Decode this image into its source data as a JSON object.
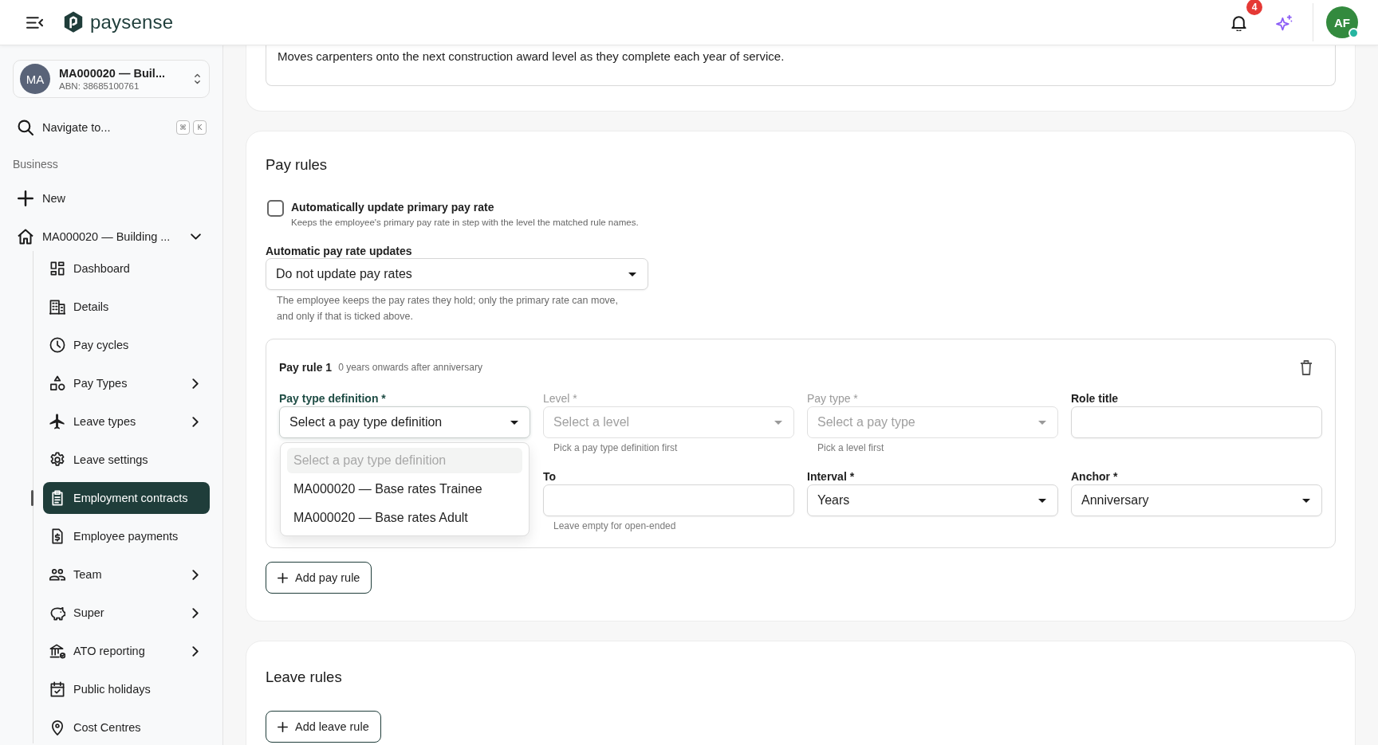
{
  "header": {
    "logo": "paysense",
    "notifications": "4",
    "avatar": {
      "initials": "AF",
      "online": true
    }
  },
  "sidebar": {
    "business": {
      "initials": "MA",
      "name": "MA000020 — Buil...",
      "abn": "ABN: 38685100761"
    },
    "search": {
      "label": "Navigate to...",
      "keys": [
        "⌘",
        "K"
      ]
    },
    "section_title": "Business",
    "new_item": "New",
    "organisation": {
      "label": "MA000020 — Building ...",
      "expanded": true,
      "children": [
        {
          "label": "Dashboard",
          "has_submenu": false,
          "selected": false
        },
        {
          "label": "Details",
          "has_submenu": false,
          "selected": false
        },
        {
          "label": "Pay cycles",
          "has_submenu": false,
          "selected": false
        },
        {
          "label": "Pay Types",
          "has_submenu": true,
          "selected": false
        },
        {
          "label": "Leave types",
          "has_submenu": true,
          "selected": false
        },
        {
          "label": "Leave settings",
          "has_submenu": false,
          "selected": false
        },
        {
          "label": "Employment contracts",
          "has_submenu": false,
          "selected": true
        },
        {
          "label": "Employee payments",
          "has_submenu": false,
          "selected": false
        },
        {
          "label": "Team",
          "has_submenu": true,
          "selected": false
        },
        {
          "label": "Super",
          "has_submenu": true,
          "selected": false
        },
        {
          "label": "ATO reporting",
          "has_submenu": true,
          "selected": false
        },
        {
          "label": "Public holidays",
          "has_submenu": false,
          "selected": false
        },
        {
          "label": "Cost Centres",
          "has_submenu": false,
          "selected": false
        }
      ]
    }
  },
  "previous_section": {
    "description": "Moves carpenters onto the next construction award level as they complete each year of service."
  },
  "pay_rules": {
    "title": "Pay rules",
    "auto_update": {
      "label": "Automatically update primary pay rate",
      "description": "Keeps the employee's primary pay rate in step with the level the matched rule names.",
      "checked": false
    },
    "rate_updates": {
      "label": "Automatic pay rate updates",
      "value": "Do not update pay rates",
      "help": "The employee keeps the pay rates they hold; only the primary rate can move, and only if that is ticked above."
    },
    "rules": [
      {
        "title": "Pay rule 1",
        "summary": "0 years onwards after anniversary",
        "rows": [
          [
            {
              "label": "Pay type definition *",
              "kind": "select",
              "value": "Select a pay type definition",
              "disabled": false,
              "open": true,
              "options": [
                {
                  "label": "Select a pay type definition",
                  "disabled": true,
                  "selected": true
                },
                {
                  "label": "MA000020 — Base rates Trainee",
                  "disabled": false,
                  "selected": false
                },
                {
                  "label": "MA000020 — Base rates Adult",
                  "disabled": false,
                  "selected": false
                }
              ]
            },
            {
              "label": "Level *",
              "kind": "select",
              "placeholder": "Select a level",
              "disabled": true,
              "help": "Pick a pay type definition first"
            },
            {
              "label": "Pay type *",
              "kind": "select",
              "placeholder": "Select a pay type",
              "disabled": true,
              "help": "Pick a level first"
            },
            {
              "label": "Role title",
              "kind": "text"
            }
          ],
          [
            "",
            {
              "label": "To",
              "kind": "text",
              "help": "Leave empty for open-ended"
            },
            {
              "label": "Interval *",
              "kind": "select",
              "value": "Years",
              "disabled": false
            },
            {
              "label": "Anchor *",
              "kind": "select",
              "value": "Anniversary",
              "disabled": false
            }
          ]
        ]
      }
    ],
    "add_button": "Add pay rule"
  },
  "leave_rules": {
    "title": "Leave rules",
    "add_button": "Add leave rule"
  }
}
